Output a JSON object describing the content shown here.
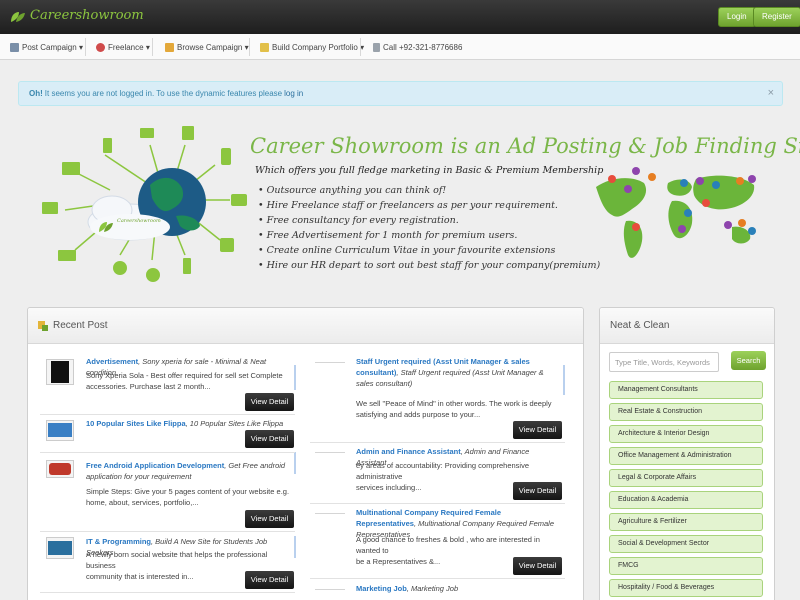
{
  "header": {
    "logo_text": "Careershowroom",
    "login_label": "Login",
    "register_label": "Register"
  },
  "nav": {
    "items": [
      {
        "label": "Post Campaign",
        "has_dropdown": true
      },
      {
        "label": "Freelance",
        "has_dropdown": true
      },
      {
        "label": "Browse Campaign",
        "has_dropdown": true
      },
      {
        "label": "Build Company Portfolio",
        "has_dropdown": true
      },
      {
        "label": "Call +92-321-8776686",
        "has_dropdown": false
      }
    ]
  },
  "alert": {
    "strong": "Oh!",
    "text": "It seems you are not logged in. To use the dynamic features please",
    "link": "log in",
    "close": "×"
  },
  "banner": {
    "title": "Career Showroom is an Ad Posting & Job Finding Site",
    "subtitle": "Which offers you full fledge marketing in Basic & Premium Membership",
    "cloud_logo_text": "Careershowroom",
    "features": [
      "Outsource anything you can think of!",
      "Hire Freelance staff or freelancers as per your requirement.",
      "Free consultancy for every registration.",
      "Free Advertisement for 1 month for premium users.",
      "Create online Curriculum Vitae in your favourite extensions",
      "Hire our HR depart to sort out best staff for your company(premium)"
    ]
  },
  "recent": {
    "title": "Recent Post",
    "view_label": "View Detail",
    "left_posts": [
      {
        "title": "Advertisement",
        "subtitle": ", Sony xperia for sale - Minimal & Neat condition",
        "desc": [
          "Sony Xperia Sola - Best offer required for sell set Complete",
          "accessories. Purchase last 2 month..."
        ]
      },
      {
        "title": "10 Popular Sites Like Flippa",
        "subtitle": ", 10 Popular Sites Like Flippa",
        "desc": []
      },
      {
        "title": "Free Android Application Development",
        "subtitle": ", Get Free android application for your requirement",
        "desc": [
          "Simple Steps: Give your 5 pages content of your website e.g.",
          "home, about, services, portfolio,..."
        ]
      },
      {
        "title": "IT & Programming",
        "subtitle": ", Build A New Site for Students Job Seekers",
        "desc": [
          "A newly born social website that helps the professional business",
          "community that is interested in..."
        ]
      }
    ],
    "right_posts": [
      {
        "title": "Staff Urgent required (Asst Unit Manager & sales consultant)",
        "subtitle": ", Staff Urgent required (Asst Unit Manager & sales consultant)",
        "desc": [
          "We sell \"Peace of Mind\" in other words. The work is deeply",
          "satisfying and adds purpose to your..."
        ]
      },
      {
        "title": "Admin and Finance Assistant",
        "subtitle": ", Admin and Finance Assistant",
        "desc": [
          "ey areas of accountability: Providing comprehensive administrative",
          "services including..."
        ]
      },
      {
        "title": "Multinational Company Required Female Representatives",
        "subtitle": ", Multinational Company Required Female Representatives",
        "desc": [
          "A good chance to freshes & bold , who are interested in wanted to",
          "be a Representatives &..."
        ]
      },
      {
        "title": "Marketing Job",
        "subtitle": ", Marketing Job",
        "desc": []
      }
    ]
  },
  "sidebar": {
    "title": "Neat & Clean",
    "search_placeholder": "Type Title, Words, Keywords",
    "search_button": "Search",
    "categories": [
      "Management Consultants",
      "Real Estate & Construction",
      "Architecture & Interior Design",
      "Office Management & Administration",
      "Legal & Corporate Affairs",
      "Education & Academia",
      "Agriculture & Fertilizer",
      "Social & Development Sector",
      "FMCG",
      "Hospitality / Food & Beverages"
    ]
  }
}
